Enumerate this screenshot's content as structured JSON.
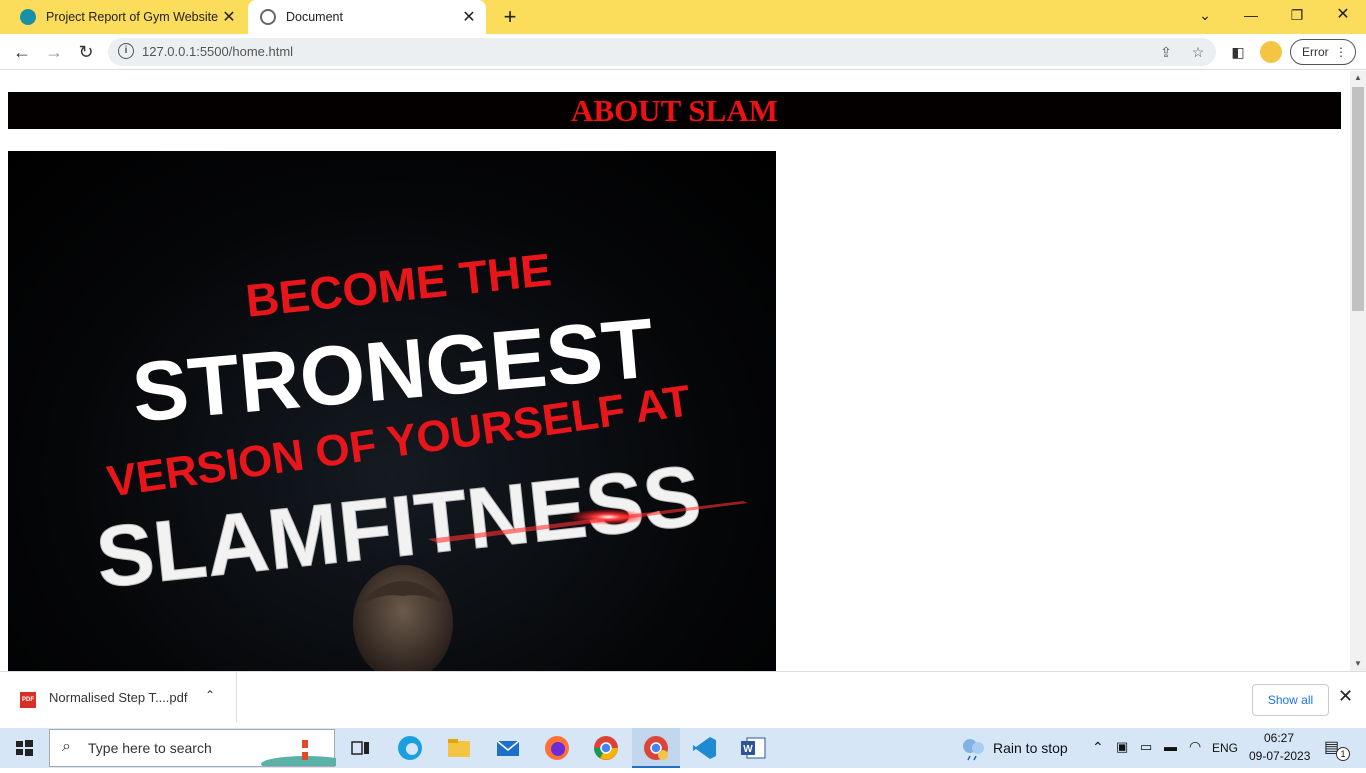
{
  "browser": {
    "tabs": [
      {
        "title": "Project Report of Gym Website | B",
        "active": false
      },
      {
        "title": "Document",
        "active": true
      }
    ],
    "url": "127.0.0.1:5500/home.html",
    "error_label": "Error"
  },
  "page": {
    "heading": "ABOUT SLAM",
    "poster_lines": [
      "BECOME THE",
      "STRONGEST",
      "VERSION OF YOURSELF AT",
      "SLAMFITNESS"
    ]
  },
  "downloads": {
    "file": "Normalised Step T....pdf",
    "pdf_label": "PDF",
    "show_all": "Show all"
  },
  "taskbar": {
    "search_placeholder": "Type here to search",
    "weather": "Rain to stop",
    "language": "ENG",
    "time": "06:27",
    "date": "09-07-2023",
    "notification_count": "1"
  },
  "colors": {
    "tabbar": "#fbdc5b",
    "heading_bg": "#050000",
    "heading_text": "#ee1111",
    "poster_red": "#e8151b"
  }
}
